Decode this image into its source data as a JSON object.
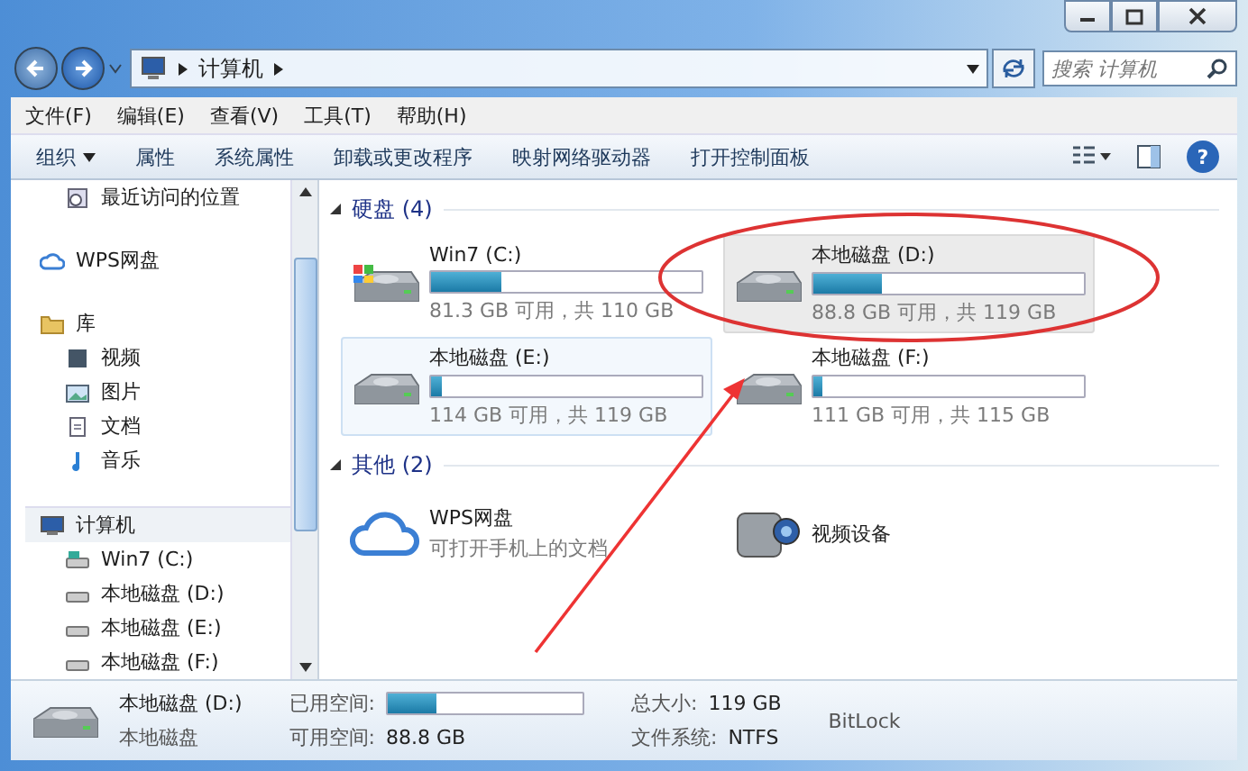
{
  "address_bar": {
    "segments": [
      "计算机"
    ]
  },
  "search": {
    "placeholder": "搜索 计算机"
  },
  "help_button": "?",
  "menu": [
    "文件(F)",
    "编辑(E)",
    "查看(V)",
    "工具(T)",
    "帮助(H)"
  ],
  "toolbar": [
    {
      "label": "组织",
      "dropdown": true
    },
    {
      "label": "属性",
      "dropdown": false
    },
    {
      "label": "系统属性",
      "dropdown": false
    },
    {
      "label": "卸载或更改程序",
      "dropdown": false
    },
    {
      "label": "映射网络驱动器",
      "dropdown": false
    },
    {
      "label": "打开控制面板",
      "dropdown": false
    }
  ],
  "sidebar": {
    "items": [
      {
        "label": "最近访问的位置",
        "kind": "recent",
        "selected": false
      },
      {
        "label": "WPS网盘",
        "kind": "cloud",
        "selected": false
      },
      {
        "label": "库",
        "kind": "library",
        "selected": false,
        "children": [
          {
            "label": "视频",
            "kind": "video",
            "selected": false
          },
          {
            "label": "图片",
            "kind": "picture",
            "selected": false
          },
          {
            "label": "文档",
            "kind": "document",
            "selected": false
          },
          {
            "label": "音乐",
            "kind": "music",
            "selected": false
          }
        ]
      },
      {
        "label": "计算机",
        "kind": "computer",
        "selected": true,
        "children": [
          {
            "label": "Win7 (C:)",
            "kind": "system",
            "selected": false
          },
          {
            "label": "本地磁盘 (D:)",
            "kind": "drive",
            "selected": false
          },
          {
            "label": "本地磁盘 (E:)",
            "kind": "drive",
            "selected": false
          },
          {
            "label": "本地磁盘 (F:)",
            "kind": "drive",
            "selected": false
          }
        ]
      }
    ]
  },
  "groups": [
    {
      "title": "硬盘 (4)",
      "kind": "drives",
      "items": [
        {
          "name": "Win7 (C:)",
          "kind": "system",
          "level": 0.26,
          "space": "81.3 GB 可用，共 110 GB",
          "selected": false,
          "hovered": false
        },
        {
          "name": "本地磁盘 (D:)",
          "kind": "drive",
          "level": 0.25,
          "space": "88.8 GB 可用，共 119 GB",
          "selected": true,
          "hovered": false
        },
        {
          "name": "本地磁盘 (E:)",
          "kind": "drive",
          "level": 0.04,
          "space": "114 GB 可用，共 119 GB",
          "selected": false,
          "hovered": true
        },
        {
          "name": "本地磁盘 (F:)",
          "kind": "drive",
          "level": 0.035,
          "space": "111 GB 可用，共 115 GB",
          "selected": false,
          "hovered": false
        }
      ]
    },
    {
      "title": "其他 (2)",
      "kind": "other",
      "items": [
        {
          "name": "WPS网盘",
          "kind": "cloud",
          "subtitle": "可打开手机上的文档"
        },
        {
          "name": "视频设备",
          "kind": "camera"
        }
      ]
    }
  ],
  "details": {
    "name": "本地磁盘 (D:)",
    "type": "本地磁盘",
    "used_label": "已用空间:",
    "level": 0.25,
    "free_label": "可用空间:",
    "free": "88.8 GB",
    "total_label": "总大小:",
    "total": "119 GB",
    "fs_label": "文件系统:",
    "fs": "NTFS",
    "bitlocker": "BitLock"
  }
}
